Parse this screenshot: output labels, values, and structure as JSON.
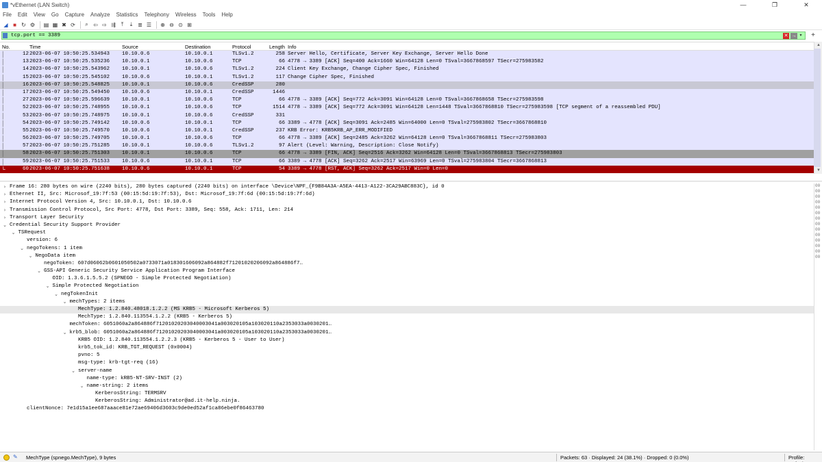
{
  "window": {
    "title": "*vEthernet (LAN Switch)",
    "controls": [
      "—",
      "❐",
      "✕"
    ]
  },
  "menu": [
    "File",
    "Edit",
    "View",
    "Go",
    "Capture",
    "Analyze",
    "Statistics",
    "Telephony",
    "Wireless",
    "Tools",
    "Help"
  ],
  "filter": {
    "value": "tcp.port == 3389"
  },
  "packet_list": {
    "columns": [
      "No.",
      "Time",
      "Source",
      "Destination",
      "Protocol",
      "Length",
      "Info"
    ],
    "rows": [
      {
        "no": "12",
        "time": "2023-06-07 10:50:25.534943",
        "src": "10.10.0.6",
        "dst": "10.10.0.1",
        "proto": "TLSv1.2",
        "len": "258",
        "info": "Server Hello, Certificate, Server Key Exchange, Server Hello Done",
        "style": "lav"
      },
      {
        "no": "13",
        "time": "2023-06-07 10:50:25.535236",
        "src": "10.10.0.1",
        "dst": "10.10.0.6",
        "proto": "TCP",
        "len": "66",
        "info": "4778 → 3389 [ACK] Seq=400 Ack=1660 Win=64128 Len=0 TSval=3667868597 TSecr=275983582",
        "style": "lav"
      },
      {
        "no": "14",
        "time": "2023-06-07 10:50:25.543962",
        "src": "10.10.0.1",
        "dst": "10.10.0.6",
        "proto": "TLSv1.2",
        "len": "224",
        "info": "Client Key Exchange, Change Cipher Spec, Finished",
        "style": "lav"
      },
      {
        "no": "15",
        "time": "2023-06-07 10:50:25.545102",
        "src": "10.10.0.6",
        "dst": "10.10.0.1",
        "proto": "TLSv1.2",
        "len": "117",
        "info": "Change Cipher Spec, Finished",
        "style": "lav"
      },
      {
        "no": "16",
        "time": "2023-06-07 10:50:25.548825",
        "src": "10.10.0.1",
        "dst": "10.10.0.6",
        "proto": "CredSSP",
        "len": "280",
        "info": "",
        "style": "sel"
      },
      {
        "no": "17",
        "time": "2023-06-07 10:50:25.549450",
        "src": "10.10.0.6",
        "dst": "10.10.0.1",
        "proto": "CredSSP",
        "len": "1446",
        "info": "",
        "style": "lav"
      },
      {
        "no": "27",
        "time": "2023-06-07 10:50:25.596639",
        "src": "10.10.0.1",
        "dst": "10.10.0.6",
        "proto": "TCP",
        "len": "66",
        "info": "4778 → 3389 [ACK] Seq=772 Ack=3091 Win=64128 Len=0 TSval=3667868658 TSecr=275983598",
        "style": "lav"
      },
      {
        "no": "52",
        "time": "2023-06-07 10:50:25.748955",
        "src": "10.10.0.1",
        "dst": "10.10.0.6",
        "proto": "TCP",
        "len": "1514",
        "info": "4778 → 3389 [ACK] Seq=772 Ack=3091 Win=64128 Len=1448 TSval=3667868810 TSecr=275983598 [TCP segment of a reassembled PDU]",
        "style": "lav"
      },
      {
        "no": "53",
        "time": "2023-06-07 10:50:25.748975",
        "src": "10.10.0.1",
        "dst": "10.10.0.6",
        "proto": "CredSSP",
        "len": "331",
        "info": "",
        "style": "lav"
      },
      {
        "no": "54",
        "time": "2023-06-07 10:50:25.749142",
        "src": "10.10.0.6",
        "dst": "10.10.0.1",
        "proto": "TCP",
        "len": "66",
        "info": "3389 → 4778 [ACK] Seq=3091 Ack=2485 Win=64000 Len=0 TSval=275983802 TSecr=3667868810",
        "style": "lav"
      },
      {
        "no": "55",
        "time": "2023-06-07 10:50:25.749570",
        "src": "10.10.0.6",
        "dst": "10.10.0.1",
        "proto": "CredSSP",
        "len": "237",
        "info": "KRB Error: KRB5KRB_AP_ERR_MODIFIED",
        "style": "lav"
      },
      {
        "no": "56",
        "time": "2023-06-07 10:50:25.749705",
        "src": "10.10.0.1",
        "dst": "10.10.0.6",
        "proto": "TCP",
        "len": "66",
        "info": "4778 → 3389 [ACK] Seq=2485 Ack=3262 Win=64128 Len=0 TSval=3667868811 TSecr=275983803",
        "style": "lav"
      },
      {
        "no": "57",
        "time": "2023-06-07 10:50:25.751285",
        "src": "10.10.0.1",
        "dst": "10.10.0.6",
        "proto": "TLSv1.2",
        "len": "97",
        "info": "Alert (Level: Warning, Description: Close Notify)",
        "style": "lav"
      },
      {
        "no": "58",
        "time": "2023-06-07 10:50:25.751303",
        "src": "10.10.0.1",
        "dst": "10.10.0.6",
        "proto": "TCP",
        "len": "66",
        "info": "4778 → 3389 [FIN, ACK] Seq=2516 Ack=3262 Win=64128 Len=0 TSval=3667868813 TSecr=275983803",
        "style": "gray"
      },
      {
        "no": "59",
        "time": "2023-06-07 10:50:25.751533",
        "src": "10.10.0.6",
        "dst": "10.10.0.1",
        "proto": "TCP",
        "len": "66",
        "info": "3389 → 4778 [ACK] Seq=3262 Ack=2517 Win=63969 Len=0 TSval=275983804 TSecr=3667868813",
        "style": "lav"
      },
      {
        "no": "60",
        "time": "2023-06-07 10:50:25.751638",
        "src": "10.10.0.6",
        "dst": "10.10.0.1",
        "proto": "TCP",
        "len": "54",
        "info": "3389 → 4778 [RST, ACK] Seq=3262 Ack=2517 Win=0 Len=0",
        "style": "red"
      }
    ]
  },
  "details": [
    {
      "indent": 0,
      "tw": "›",
      "text": "Frame 16: 280 bytes on wire (2240 bits), 280 bytes captured (2240 bits) on interface \\Device\\NPF_{F9B84A3A-A5EA-4413-A122-3CA29ABC883C}, id 0"
    },
    {
      "indent": 0,
      "tw": "›",
      "text": "Ethernet II, Src: Microsof_19:7f:53 (00:15:5d:19:7f:53), Dst: Microsof_19:7f:6d (00:15:5d:19:7f:6d)"
    },
    {
      "indent": 0,
      "tw": "›",
      "text": "Internet Protocol Version 4, Src: 10.10.0.1, Dst: 10.10.0.6"
    },
    {
      "indent": 0,
      "tw": "›",
      "text": "Transmission Control Protocol, Src Port: 4778, Dst Port: 3389, Seq: 558, Ack: 1711, Len: 214"
    },
    {
      "indent": 0,
      "tw": "›",
      "text": "Transport Layer Security"
    },
    {
      "indent": 0,
      "tw": "⌄",
      "text": "Credential Security Support Provider"
    },
    {
      "indent": 1,
      "tw": "⌄",
      "text": "TSRequest"
    },
    {
      "indent": 2,
      "tw": "",
      "text": "version: 6"
    },
    {
      "indent": 2,
      "tw": "⌄",
      "text": "negoTokens: 1 item"
    },
    {
      "indent": 3,
      "tw": "⌄",
      "text": "NegoData item"
    },
    {
      "indent": 4,
      "tw": "",
      "text": "negoToken: 607d06062b0601050502a0733071a018301606092a864882f71201020206092a864886f7…"
    },
    {
      "indent": 4,
      "tw": "⌄",
      "text": "GSS-API Generic Security Service Application Program Interface"
    },
    {
      "indent": 5,
      "tw": "",
      "text": "OID: 1.3.6.1.5.5.2 (SPNEGO - Simple Protected Negotiation)"
    },
    {
      "indent": 5,
      "tw": "⌄",
      "text": "Simple Protected Negotiation"
    },
    {
      "indent": 6,
      "tw": "⌄",
      "text": "negTokenInit"
    },
    {
      "indent": 7,
      "tw": "⌄",
      "text": "mechTypes: 2 items"
    },
    {
      "indent": 8,
      "tw": "",
      "text": "MechType: 1.2.840.48018.1.2.2 (MS KRB5 - Microsoft Kerberos 5)",
      "hl": true
    },
    {
      "indent": 8,
      "tw": "",
      "text": "MechType: 1.2.840.113554.1.2.2 (KRB5 - Kerberos 5)"
    },
    {
      "indent": 7,
      "tw": "",
      "text": "mechToken: 6051060a2a864886f71201020203040003041a003020105a103020110a2353033a0030201…"
    },
    {
      "indent": 7,
      "tw": "⌄",
      "text": "krb5_blob: 6051060a2a864886f71201020203040003041a003020105a103020110a2353033a0030201…"
    },
    {
      "indent": 8,
      "tw": "",
      "text": "KRB5 OID: 1.2.840.113554.1.2.2.3 (KRB5 - Kerberos 5 - User to User)"
    },
    {
      "indent": 8,
      "tw": "",
      "text": "krb5_tok_id: KRB_TGT_REQUEST (0x0004)"
    },
    {
      "indent": 8,
      "tw": "",
      "text": "pvno: 5"
    },
    {
      "indent": 8,
      "tw": "",
      "text": "msg-type: krb-tgt-req (16)"
    },
    {
      "indent": 8,
      "tw": "⌄",
      "text": "server-name"
    },
    {
      "indent": 9,
      "tw": "",
      "text": "name-type: kRB5-NT-SRV-INST (2)"
    },
    {
      "indent": 9,
      "tw": "⌄",
      "text": "name-string: 2 items"
    },
    {
      "indent": 10,
      "tw": "",
      "text": "KerberosString: TERMSRV"
    },
    {
      "indent": 10,
      "tw": "",
      "text": "KerberosString: Administrator@ad.it-help.ninja."
    },
    {
      "indent": 2,
      "tw": "",
      "text": "clientNonce: 7e1d15a1ee687aaace81e72ae69406d3603c9de0ed52af1ca86ebe0f86463780"
    }
  ],
  "bytes_hint": [
    "00",
    "00",
    "00",
    "00",
    "00",
    "00",
    "00",
    "00",
    "00",
    "00",
    "00",
    "00",
    "00",
    "00"
  ],
  "status": {
    "field": "MechType (spnego.MechType), 9 bytes",
    "packets": "Packets: 63 · Displayed: 24 (38.1%) · Dropped: 0 (0.0%)",
    "profile": "Profile: Default"
  },
  "colors": {
    "lav": "#e4e4fe",
    "sel": "#c8c8d4",
    "gray": "#a0a0a0",
    "red": "#a40000",
    "filter_ok": "#afffaf"
  },
  "icons": [
    "shark-fin-icon",
    "stop-icon",
    "restart-icon",
    "options-icon",
    "open-icon",
    "save-icon",
    "close-file-icon",
    "reload-icon",
    "find-icon",
    "back-icon",
    "forward-icon",
    "goto-icon",
    "first-icon",
    "last-icon",
    "autoscroll-icon",
    "colorize-icon",
    "zoom-in-icon",
    "zoom-out-icon",
    "zoom-reset-icon",
    "resize-columns-icon"
  ]
}
